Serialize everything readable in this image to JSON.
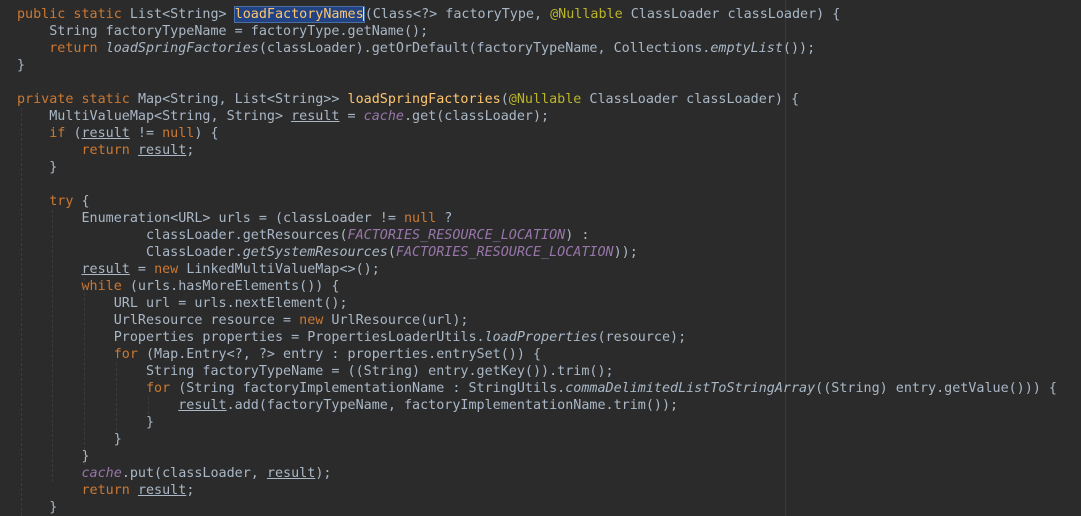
{
  "code_lines": [
    [
      [
        "public static ",
        "kw"
      ],
      [
        "List<String> ",
        ""
      ],
      [
        "loadFactoryNames",
        "fn hl"
      ],
      [
        "",
        "cursor"
      ],
      [
        "(Class<?> factoryType, ",
        ""
      ],
      [
        "@Nullable",
        "ann"
      ],
      [
        " ClassLoader classLoader) {",
        ""
      ]
    ],
    [
      [
        "    String factoryTypeName = factoryType.getName();",
        ""
      ]
    ],
    [
      [
        "    ",
        ""
      ],
      [
        "return ",
        "kw"
      ],
      [
        "loadSpringFactories",
        "static"
      ],
      [
        "(classLoader).getOrDefault(factoryTypeName, Collections.",
        ""
      ],
      [
        "emptyList",
        "static"
      ],
      [
        "());",
        ""
      ]
    ],
    [
      [
        "}",
        ""
      ]
    ],
    [
      [
        "",
        ""
      ]
    ],
    [
      [
        "private static ",
        "kw"
      ],
      [
        "Map<String, List<String>> ",
        ""
      ],
      [
        "loadSpringFactories",
        "fn"
      ],
      [
        "(",
        ""
      ],
      [
        "@Nullable",
        "ann"
      ],
      [
        " ClassLoader classLoader) {",
        ""
      ]
    ],
    [
      [
        "    MultiValueMap<String, String> ",
        ""
      ],
      [
        "result",
        "ul"
      ],
      [
        " = ",
        ""
      ],
      [
        "cache",
        "field"
      ],
      [
        ".get(classLoader);",
        ""
      ]
    ],
    [
      [
        "    ",
        ""
      ],
      [
        "if ",
        "kw"
      ],
      [
        "(",
        ""
      ],
      [
        "result",
        "ul"
      ],
      [
        " != ",
        ""
      ],
      [
        "null",
        "kw"
      ],
      [
        ") {",
        ""
      ]
    ],
    [
      [
        "        ",
        ""
      ],
      [
        "return ",
        "kw"
      ],
      [
        "result",
        "ul"
      ],
      [
        ";",
        ""
      ]
    ],
    [
      [
        "    }",
        ""
      ]
    ],
    [
      [
        "",
        ""
      ]
    ],
    [
      [
        "    ",
        ""
      ],
      [
        "try ",
        "kw"
      ],
      [
        "{",
        ""
      ]
    ],
    [
      [
        "        Enumeration<URL> urls = (classLoader != ",
        ""
      ],
      [
        "null ",
        "kw"
      ],
      [
        "?",
        ""
      ]
    ],
    [
      [
        "                classLoader.getResources(",
        ""
      ],
      [
        "FACTORIES_RESOURCE_LOCATION",
        "field"
      ],
      [
        ") :",
        ""
      ]
    ],
    [
      [
        "                ClassLoader.",
        ""
      ],
      [
        "getSystemResources",
        "static"
      ],
      [
        "(",
        ""
      ],
      [
        "FACTORIES_RESOURCE_LOCATION",
        "field"
      ],
      [
        "));",
        ""
      ]
    ],
    [
      [
        "        ",
        ""
      ],
      [
        "result",
        "ul"
      ],
      [
        " = ",
        ""
      ],
      [
        "new ",
        "kw"
      ],
      [
        "LinkedMultiValueMap<>();",
        ""
      ]
    ],
    [
      [
        "        ",
        ""
      ],
      [
        "while ",
        "kw"
      ],
      [
        "(urls.hasMoreElements()) {",
        ""
      ]
    ],
    [
      [
        "            URL url = urls.nextElement();",
        ""
      ]
    ],
    [
      [
        "            UrlResource resource = ",
        ""
      ],
      [
        "new ",
        "kw"
      ],
      [
        "UrlResource(url);",
        ""
      ]
    ],
    [
      [
        "            Properties properties = PropertiesLoaderUtils.",
        ""
      ],
      [
        "loadProperties",
        "static"
      ],
      [
        "(resource);",
        ""
      ]
    ],
    [
      [
        "            ",
        ""
      ],
      [
        "for ",
        "kw"
      ],
      [
        "(Map.Entry<?, ?> entry : properties.entrySet()) {",
        ""
      ]
    ],
    [
      [
        "                String factoryTypeName = ((String) entry.getKey()).trim();",
        ""
      ]
    ],
    [
      [
        "                ",
        ""
      ],
      [
        "for ",
        "kw"
      ],
      [
        "(String factoryImplementationName : StringUtils.",
        ""
      ],
      [
        "commaDelimitedListToStringArray",
        "static"
      ],
      [
        "((String) entry.getValue())) {",
        ""
      ]
    ],
    [
      [
        "                    ",
        ""
      ],
      [
        "result",
        "ul"
      ],
      [
        ".add(factoryTypeName, factoryImplementationName.trim());",
        ""
      ]
    ],
    [
      [
        "                }",
        ""
      ]
    ],
    [
      [
        "            }",
        ""
      ]
    ],
    [
      [
        "        }",
        ""
      ]
    ],
    [
      [
        "        ",
        ""
      ],
      [
        "cache",
        "field"
      ],
      [
        ".put(classLoader, ",
        ""
      ],
      [
        "result",
        "ul"
      ],
      [
        ");",
        ""
      ]
    ],
    [
      [
        "        ",
        ""
      ],
      [
        "return ",
        "kw"
      ],
      [
        "result",
        "ul"
      ],
      [
        ";",
        ""
      ]
    ],
    [
      [
        "    }",
        ""
      ]
    ]
  ],
  "colors": {
    "background": "#2b2b2b",
    "text": "#a9b7c6",
    "keyword": "#cc7832",
    "function": "#ffc66d",
    "annotation": "#bbb529",
    "field": "#9876aa",
    "selection": "#214283"
  }
}
